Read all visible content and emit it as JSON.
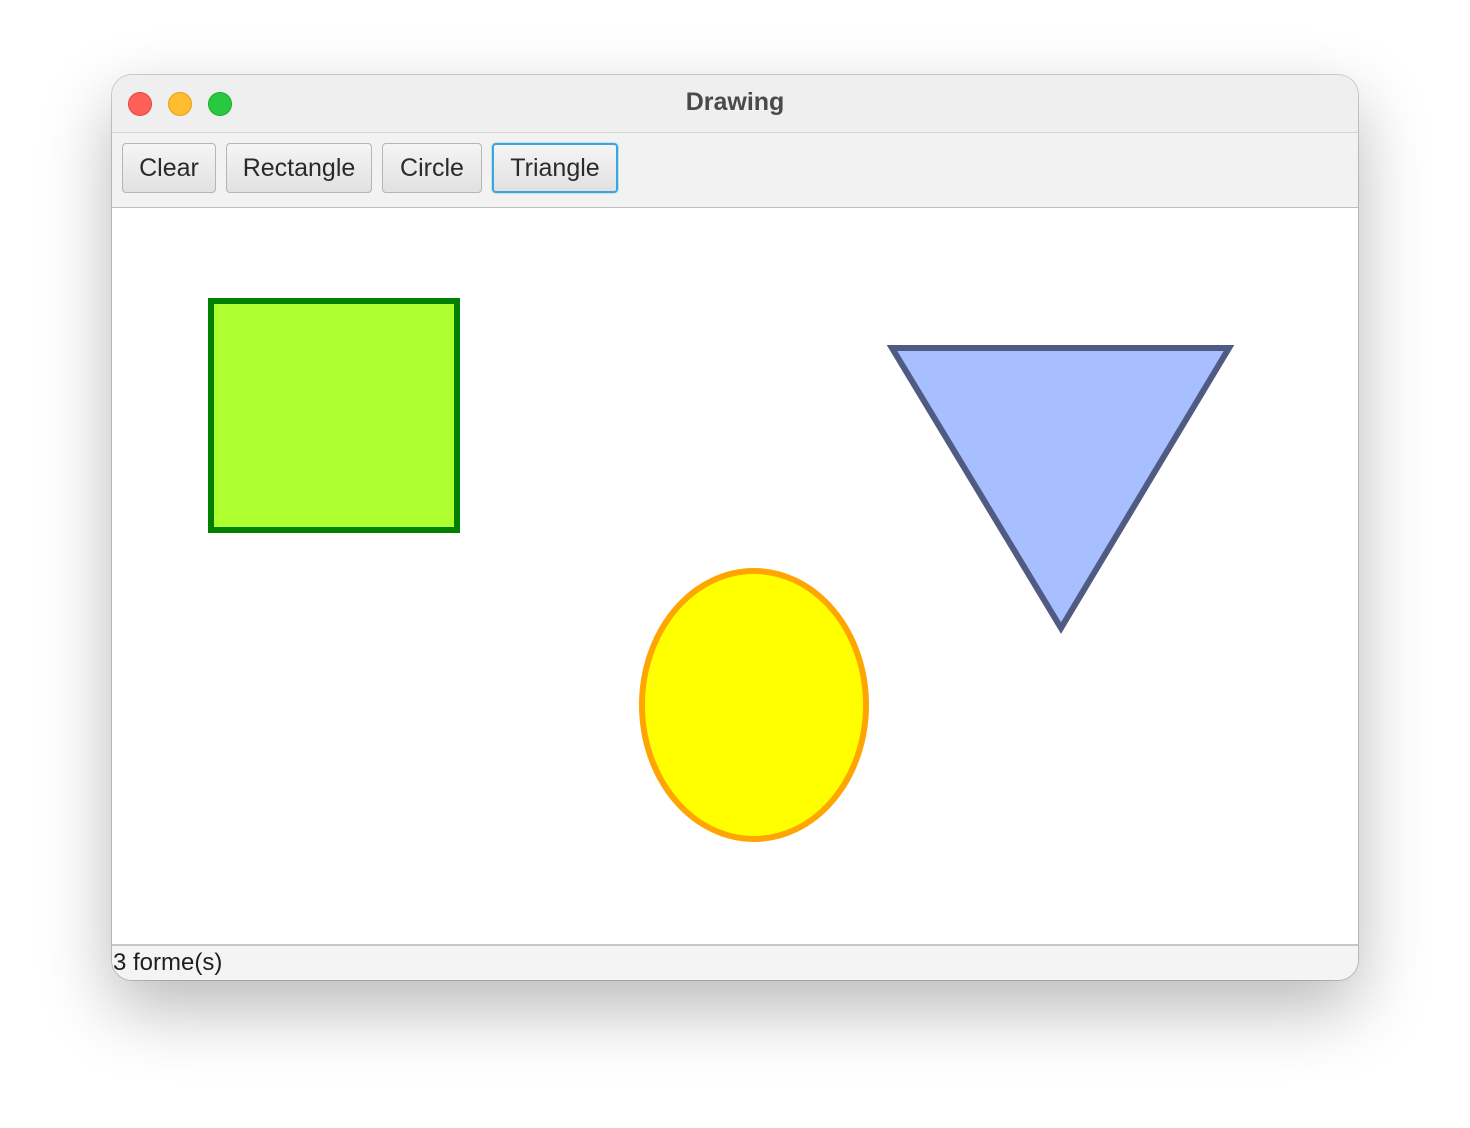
{
  "window": {
    "title": "Drawing"
  },
  "toolbar": {
    "buttons": [
      {
        "label": "Clear"
      },
      {
        "label": "Rectangle"
      },
      {
        "label": "Circle"
      },
      {
        "label": "Triangle"
      }
    ],
    "focused_button": "Triangle"
  },
  "canvas": {
    "shapes": [
      {
        "kind": "rectangle",
        "fill": "#adff2f",
        "stroke": "#008000"
      },
      {
        "kind": "ellipse",
        "fill": "#ffff00",
        "stroke": "#ffa500"
      },
      {
        "kind": "triangle",
        "fill": "#a7bfff",
        "stroke": "#4f5b82"
      }
    ]
  },
  "status": {
    "text": "3 forme(s)"
  },
  "colors": {
    "traffic_close": "#fe5f57",
    "traffic_minimize": "#febc2e",
    "traffic_maximize": "#28c840",
    "focus_ring": "#3ba6dc"
  }
}
